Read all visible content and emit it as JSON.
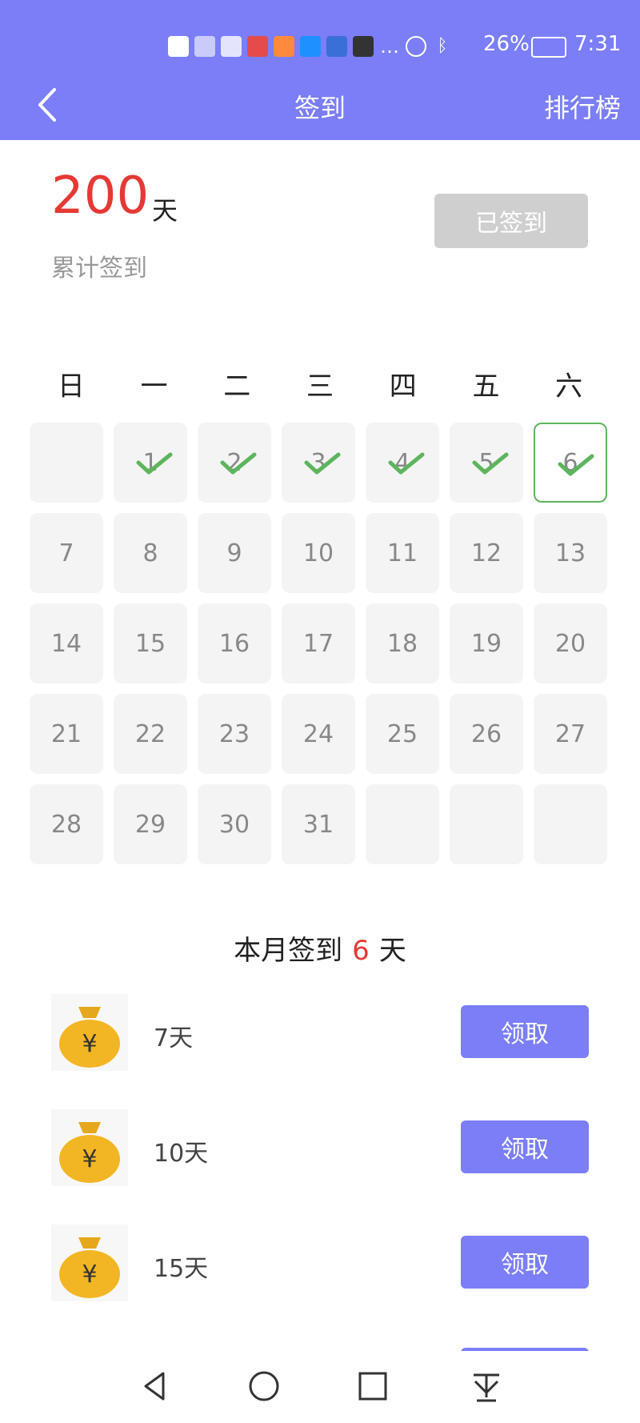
{
  "status": {
    "battery": "26%",
    "time": "7:31"
  },
  "nav": {
    "title": "签到",
    "right_link": "排行榜"
  },
  "summary": {
    "days": "200",
    "unit": "天",
    "label": "累计签到",
    "signed_button": "已签到"
  },
  "weekdays": [
    "日",
    "一",
    "二",
    "三",
    "四",
    "五",
    "六"
  ],
  "calendar": {
    "cells": [
      "",
      "1",
      "2",
      "3",
      "4",
      "5",
      "6",
      "7",
      "8",
      "9",
      "10",
      "11",
      "12",
      "13",
      "14",
      "15",
      "16",
      "17",
      "18",
      "19",
      "20",
      "21",
      "22",
      "23",
      "24",
      "25",
      "26",
      "27",
      "28",
      "29",
      "30",
      "31",
      "",
      "",
      ""
    ],
    "checked": [
      1,
      2,
      3,
      4,
      5,
      6
    ],
    "today": 6
  },
  "month_summary": {
    "prefix": "本月签到",
    "count": "6",
    "suffix": "天"
  },
  "rewards": [
    {
      "label": "7天",
      "button": "领取"
    },
    {
      "label": "10天",
      "button": "领取"
    },
    {
      "label": "15天",
      "button": "领取"
    }
  ],
  "colors": {
    "accent": "#7B7EF6",
    "highlight": "#E53935",
    "check": "#5DB55D",
    "disabled": "#CFCFCF"
  }
}
